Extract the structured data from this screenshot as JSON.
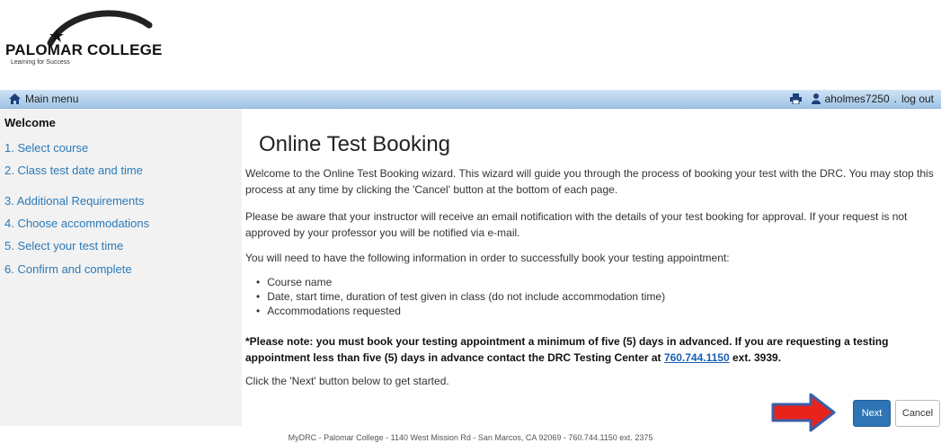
{
  "logo": {
    "name": "PALOMAR COLLEGE",
    "tagline": "Learning for Success"
  },
  "topbar": {
    "home_label": "Main menu",
    "user": "aholmes7250",
    "separator": ".",
    "logout": "log out"
  },
  "sidebar": {
    "welcome": "Welcome",
    "items": [
      {
        "label": "1. Select course"
      },
      {
        "label": "2. Class test date and time"
      },
      {
        "label": "3. Additional Requirements"
      },
      {
        "label": "4. Choose accommodations"
      },
      {
        "label": "5. Select your test time"
      },
      {
        "label": "6. Confirm and complete"
      }
    ]
  },
  "main": {
    "title": "Online Test Booking",
    "p1": "Welcome to the Online Test Booking wizard. This wizard will guide you through the process of booking your test with the DRC. You may stop this process at any time by clicking the 'Cancel' button at the bottom of each page.",
    "p2": "Please be aware that your instructor will receive an email notification with the details of your test booking for approval. If your request is not approved by your professor you will be notified via e-mail.",
    "p3": "You will need to have the following information in order to successfully book your testing appointment:",
    "bullets": [
      "Course name",
      "Date, start time, duration of test given in class (do not include accommodation time)",
      "Accommodations requested"
    ],
    "note_prefix": "*Please note: you must book your testing appointment a minimum of five (5) days in advanced. If you are requesting a testing appointment less than five (5) days in advance contact the DRC Testing Center at",
    "note_phone": "760.744.1150",
    "note_suffix": "ext. 3939.",
    "p4": "Click the 'Next' button below to get started."
  },
  "buttons": {
    "next": "Next",
    "cancel": "Cancel"
  },
  "footer": "MyDRC - Palomar College - 1140 West Mission Rd - San Marcos, CA 92069 - 760.744.1150 ext. 2375",
  "colors": {
    "accent": "#2f74b5",
    "link": "#2a7ab8",
    "arrow": "#e8231c"
  }
}
